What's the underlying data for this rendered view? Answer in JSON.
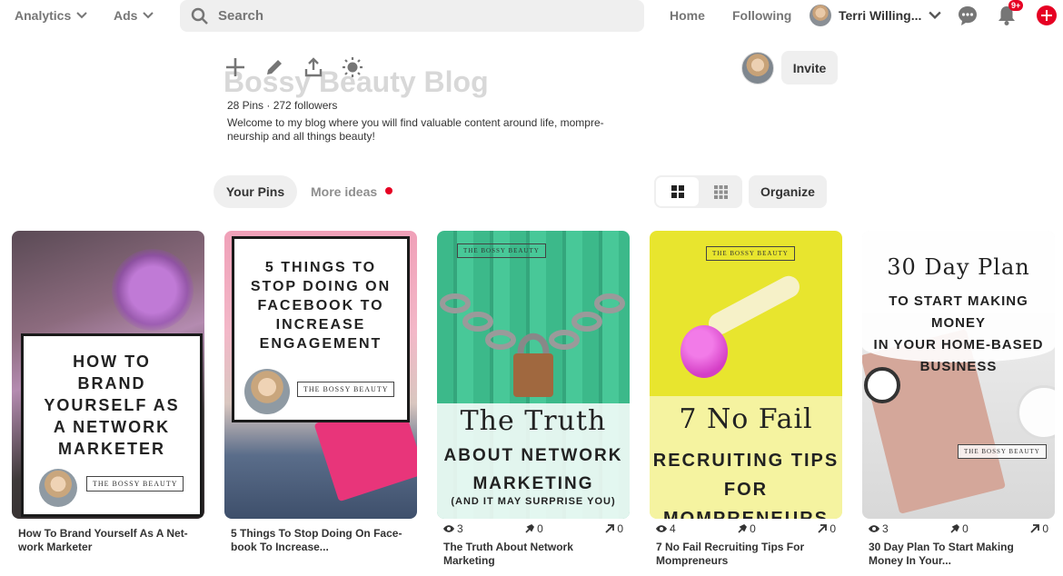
{
  "topbar": {
    "analytics_label": "Analytics",
    "ads_label": "Ads",
    "search_placeholder": "Search",
    "home_label": "Home",
    "following_label": "Following",
    "user_name": "Terri Willing...",
    "notification_badge": "9+"
  },
  "board": {
    "title": "Bossy Beauty Blog",
    "stats": "28 Pins · 272 followers",
    "description": "Welcome to my blog where you will find valuable content around life, mompre-neurship and all things beauty!",
    "invite_label": "Invite"
  },
  "tabs": {
    "your_pins": "Your Pins",
    "more_ideas": "More ideas",
    "organize": "Organize"
  },
  "pins": [
    {
      "image_lines": [
        "HOW TO",
        "BRAND",
        "YOURSELF AS",
        "A NETWORK",
        "MARKETER"
      ],
      "brand": "THE BOSSY BEAUTY",
      "title": "How To Brand Yourself As A Net-work Marketer"
    },
    {
      "image_lines": [
        "5 THINGS TO",
        "STOP DOING ON",
        "FACEBOOK TO",
        "INCREASE",
        "ENGAGEMENT"
      ],
      "brand": "THE BOSSY BEAUTY",
      "title": "5 Things To Stop Doing On Face-book To Increase..."
    },
    {
      "image_script": "The Truth",
      "image_lines": [
        "ABOUT NETWORK",
        "MARKETING",
        "(AND IT MAY SURPRISE YOU)"
      ],
      "brand": "THE BOSSY BEAUTY",
      "views": "3",
      "saves": "0",
      "clicks": "0",
      "title": "The Truth About Network Marketing"
    },
    {
      "image_script": "7 No Fail",
      "image_lines": [
        "RECRUITING TIPS",
        "FOR MOMPRENEURS"
      ],
      "brand": "THE BOSSY BEAUTY",
      "views": "4",
      "saves": "0",
      "clicks": "0",
      "title": "7 No Fail Recruiting Tips For Mompreneurs"
    },
    {
      "image_script": "30 Day Plan",
      "image_lines": [
        "TO START MAKING MONEY",
        "IN YOUR HOME-BASED",
        "BUSINESS"
      ],
      "brand": "THE BOSSY BEAUTY",
      "views": "3",
      "saves": "0",
      "clicks": "0",
      "title": "30 Day Plan To Start Making Money In Your..."
    }
  ],
  "colors": {
    "accent": "#e60023",
    "pin3_bg": "#3fbf8f",
    "pin4_bg": "#e6e32c"
  }
}
